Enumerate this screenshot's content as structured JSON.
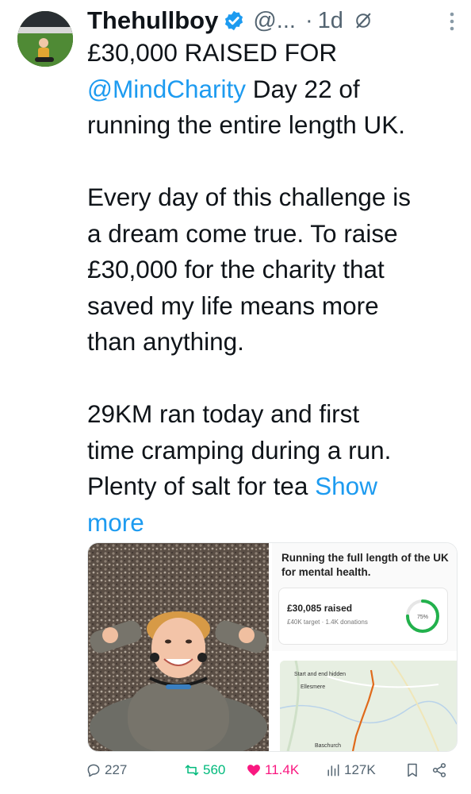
{
  "tweet": {
    "author_name": "Thehullboy",
    "handle": "@...",
    "separator": "·",
    "time": "1d",
    "line1": "£30,000 RAISED FOR",
    "mention": "@MindCharity",
    "line2_rest": " Day 22 of",
    "line3": "running the entire length UK.",
    "para2": [
      "Every day of this challenge is",
      "a dream come true. To raise",
      "£30,000 for the charity that",
      "saved my life means more",
      "than anything."
    ],
    "para3": [
      "29KM ran today and first",
      "time cramping during a run.",
      "Plenty of salt for tea "
    ],
    "show_more_1": "Show",
    "show_more_2": "more"
  },
  "media": {
    "card_title": "Running the full length of the UK for mental health.",
    "raised": "£30,085 raised",
    "target": "£40K target  ·  1.4K donations",
    "progress_label": "75%",
    "progress_fraction": 0.75,
    "map_labels": {
      "top": "Start and end hidden",
      "town1": "Ellesmere",
      "town2": "Baschurch"
    }
  },
  "actions": {
    "replies": "227",
    "reposts": "560",
    "likes": "11.4K",
    "views": "127K"
  },
  "colors": {
    "link": "#1d9bf0",
    "verified": "#1d9bf0",
    "like": "#f91880",
    "repost": "#00ba7c",
    "muted": "#536471",
    "progress": "#22b14c"
  },
  "icons": [
    "verified-badge-icon",
    "grok-icon",
    "more-icon",
    "reply-icon",
    "repost-icon",
    "like-icon",
    "views-icon",
    "bookmark-icon",
    "share-icon"
  ]
}
